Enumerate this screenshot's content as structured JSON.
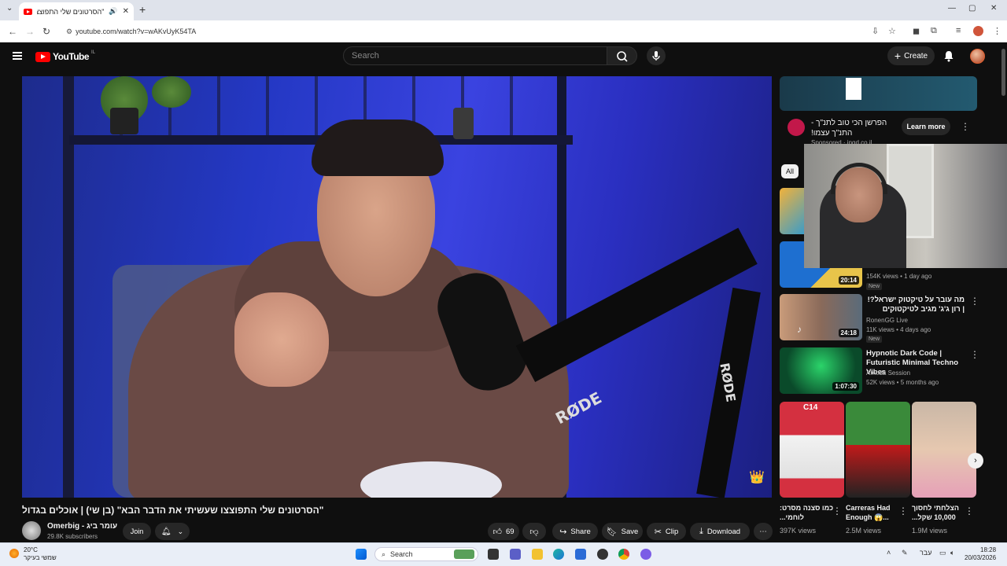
{
  "browser": {
    "tab_title": "\"הסרטונים שלי התפוצצו שעשיתי את",
    "tab_audio_icon": "speaker-icon",
    "url": "youtube.com/watch?v=wAKvUyK54TA",
    "window_min": "—",
    "window_max": "▢",
    "window_close": "✕"
  },
  "youtube": {
    "logo_text": "YouTube",
    "country_code": "IL",
    "search_placeholder": "Search",
    "create_label": "Create",
    "video_title": "\"הסרטונים שלי התפוצצו שעשיתי את הדבר הבא\" (בן שי) | אוכלים בגדול",
    "channel_name": "Omerbig - עומר ביג",
    "channel_subs": "29.8K subscribers",
    "join_label": "Join",
    "like_count": "69",
    "share_label": "Share",
    "save_label": "Save",
    "clip_label": "Clip",
    "download_label": "Download",
    "video_text": {
      "mic_brand": "RØDE",
      "boom_brand": "RØDE"
    }
  },
  "ad": {
    "title": "הפרשן הכי טוב לתנ\"ך - התנ\"ך עצמו!",
    "sponsored": "Sponsored · ingd.co.il",
    "learn_more": "Learn more"
  },
  "chips": {
    "all": "All"
  },
  "recommendations": [
    {
      "title": "",
      "channel": "",
      "meta": "154K views • 1 day ago",
      "badge": "New",
      "duration": "20:14",
      "thumb_colors": [
        "#1e6fd0",
        "#e8c44a"
      ]
    },
    {
      "title": "מה עובר על טיקטוק ישראל?! | רון ג'ג' מגיב לטיקטוקים",
      "channel": "RonenGG Live",
      "meta": "11K views • 4 days ago",
      "badge": "New",
      "duration": "24:18",
      "thumb_colors": [
        "#c99b7a",
        "#5a6b7a"
      ]
    },
    {
      "title": "Hypnotic Dark Code | Futuristic Minimal Techno Vibes",
      "channel": "Amoda Session",
      "meta": "52K views • 5 months ago",
      "badge": "",
      "duration": "1:07:30",
      "thumb_colors": [
        "#0a4a2a",
        "#2bd46a"
      ]
    }
  ],
  "shorts": [
    {
      "title": "כמו סצנה מסרט: לוחמי...",
      "views": "397K views",
      "thumb_label": "C14",
      "thumb_colors": [
        "#d43040",
        "#f2f2f2"
      ]
    },
    {
      "title": "Carreras Had Enough 😱...",
      "views": "2.5M views",
      "thumb_label": "",
      "thumb_colors": [
        "#3a8a3a",
        "#c21a1a"
      ]
    },
    {
      "title": "הצלחתי לחסוך 10,000 שקל...",
      "views": "1.9M views",
      "thumb_label": "",
      "thumb_colors": [
        "#c9b7a6",
        "#e6a0b8"
      ]
    }
  ],
  "taskbar": {
    "temp": "20°C",
    "weather_text": "שמשי בעיקר",
    "search_label": "Search",
    "lang": "עבר",
    "time": "18:28",
    "date": "20/03/2026"
  }
}
